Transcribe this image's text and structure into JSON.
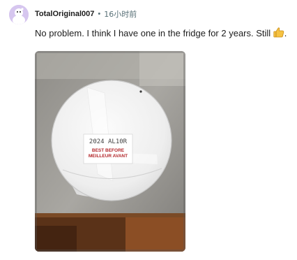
{
  "comment": {
    "username": "TotalOriginal007",
    "separator": "•",
    "timestamp": "16小时前",
    "text": "No problem. I think I have one in the fridge for 2 years. Still",
    "text_suffix": ".",
    "emoji": "thumbs-up-icon",
    "photo": {
      "label_lines": [
        "2024 AL10R",
        "BEST BEFORE",
        "MEILLEUR AVANT"
      ]
    }
  },
  "colors": {
    "avatar_bg": "#d6c6ef",
    "username": "#1c1c1c",
    "meta": "#576f76",
    "thumb": "#f5c242",
    "label_red": "#b3262a"
  }
}
